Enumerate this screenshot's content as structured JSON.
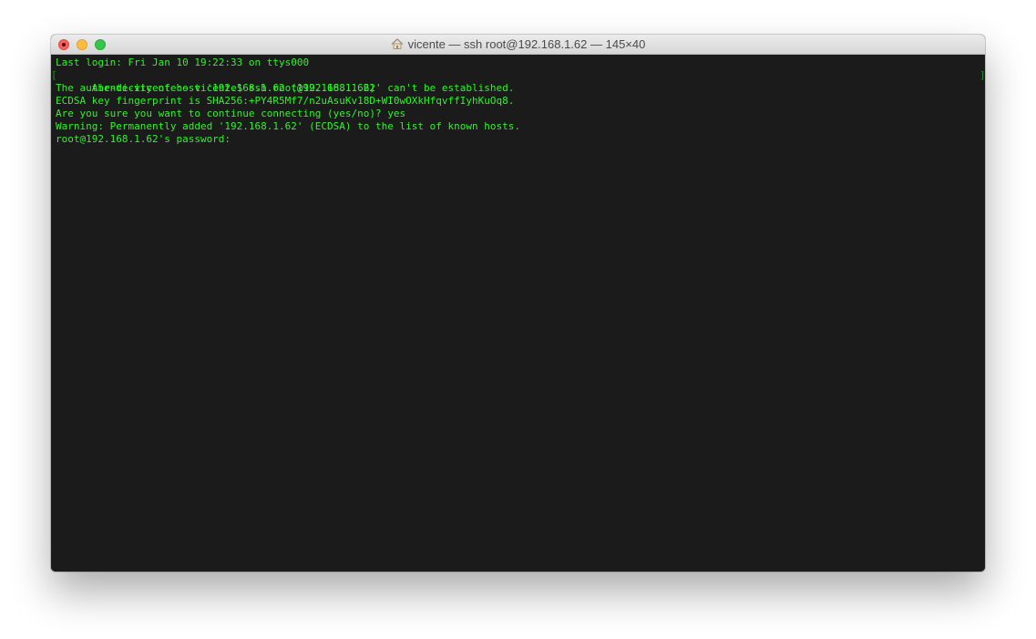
{
  "window": {
    "title": "vicente — ssh root@192.168.1.62 — 145×40",
    "home_icon": "house-icon"
  },
  "colors": {
    "terminal_bg": "#1b1b1b",
    "terminal_fg": "#2ff32a",
    "close": "#fc605b",
    "minimize": "#fdbc40",
    "maximize": "#34c84a"
  },
  "terminal": {
    "lines": [
      "Last login: Fri Jan 10 19:22:33 on ttys000",
      "Air-de-vicente:~ vicente$ ssh root@192.168.1.62",
      "The authenticity of host '192.168.1.62 (192.168.1.62)' can't be established.",
      "ECDSA key fingerprint is SHA256:+PY4R5Mf7/n2uAsuKv18D+WI0wOXkHfqvffIyhKuOq8.",
      "Are you sure you want to continue connecting (yes/no)? yes",
      "Warning: Permanently added '192.168.1.62' (ECDSA) to the list of known hosts.",
      "root@192.168.1.62's password:"
    ],
    "bracket_left": "[",
    "bracket_right": "]"
  }
}
